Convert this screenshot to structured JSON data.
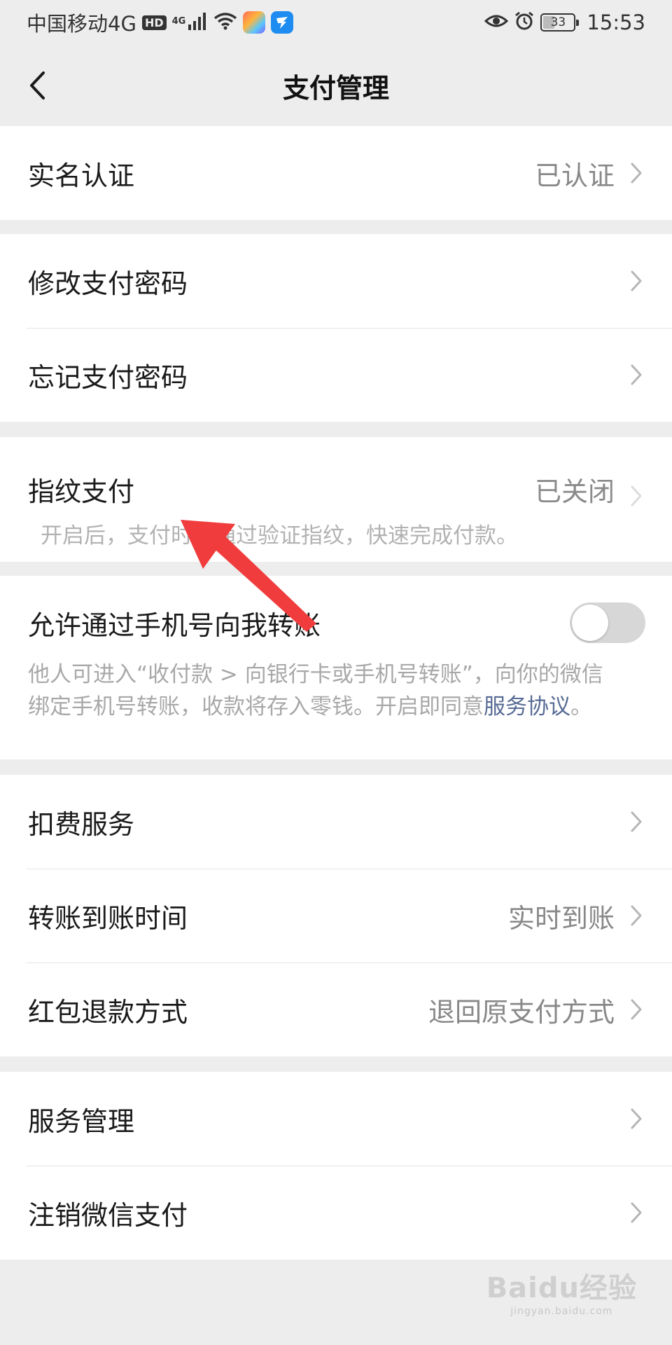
{
  "status_bar": {
    "carrier": "中国移动4G",
    "hd_badge": "HD",
    "network_small": "4G",
    "battery": "33",
    "time": "15:53"
  },
  "nav": {
    "title": "支付管理"
  },
  "groups": {
    "realname": {
      "label": "实名认证",
      "value": "已认证"
    },
    "password": [
      {
        "label": "修改支付密码"
      },
      {
        "label": "忘记支付密码"
      }
    ],
    "fingerprint": {
      "label": "指纹支付",
      "value": "已关闭",
      "description": "开启后，支付时可通过验证指纹，快速完成付款。"
    },
    "phone_transfer": {
      "label": "允许通过手机号向我转账",
      "toggle_on": false,
      "description_line1": "他人可进入“收付款 > 向银行卡或手机号转账”，向你的微信",
      "description_line2": "绑定手机号转账，收款将存入零钱。开启即同意",
      "link": "服务协议",
      "suffix": "。"
    },
    "services": [
      {
        "label": "扣费服务",
        "value": ""
      },
      {
        "label": "转账到账时间",
        "value": "实时到账"
      },
      {
        "label": "红包退款方式",
        "value": "退回原支付方式"
      }
    ],
    "manage": [
      {
        "label": "服务管理"
      },
      {
        "label": "注销微信支付"
      }
    ]
  },
  "watermark": {
    "main": "Baidu经验",
    "sub": "jingyan.baidu.com"
  },
  "colors": {
    "background": "#ededed",
    "link": "#576b95",
    "annotation_arrow": "#f03c3c"
  }
}
